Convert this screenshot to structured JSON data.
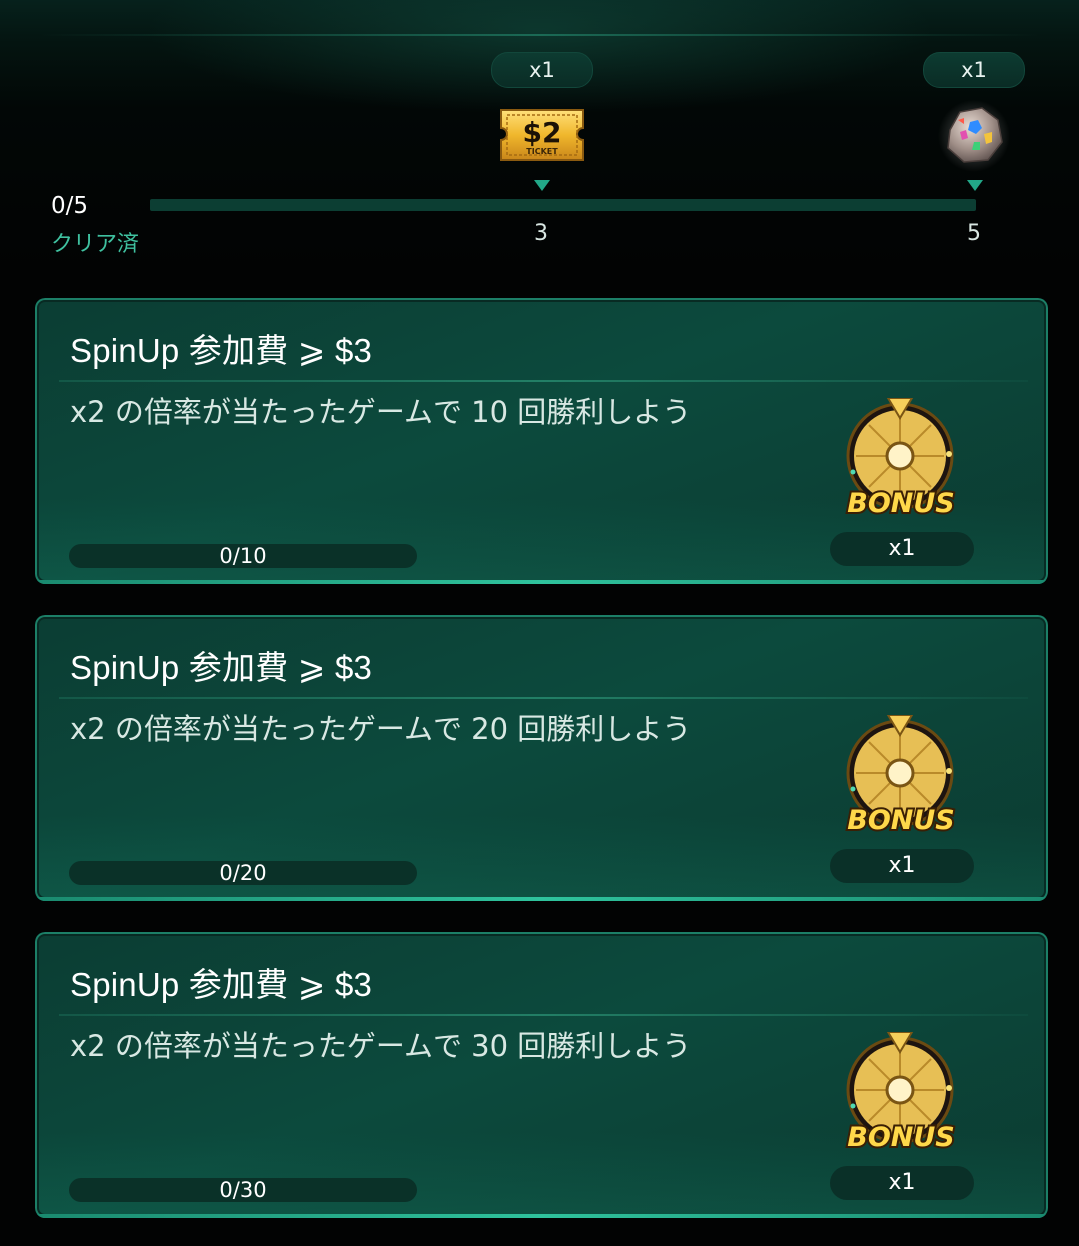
{
  "milestones": {
    "progress_count": "0/5",
    "progress_value": 0,
    "progress_max": 5,
    "cleared_label": "クリア済",
    "rewards": [
      {
        "step": "3",
        "count": "x1",
        "icon": "ticket-2-dollar-icon",
        "ticket_amount": "$2",
        "ticket_text": "TICKET"
      },
      {
        "step": "5",
        "count": "x1",
        "icon": "gem-rock-icon"
      }
    ]
  },
  "tasks": [
    {
      "title": "SpinUp 参加費 ⩾ $3",
      "description": "x2 の倍率が当たったゲームで 10 回勝利しよう",
      "progress_text": "0/10",
      "progress_value": 0,
      "progress_max": 10,
      "reward_icon": "bonus-wheel-icon",
      "reward_label": "BONUS",
      "reward_count": "x1"
    },
    {
      "title": "SpinUp 参加費 ⩾ $3",
      "description": "x2 の倍率が当たったゲームで 20 回勝利しよう",
      "progress_text": "0/20",
      "progress_value": 0,
      "progress_max": 20,
      "reward_icon": "bonus-wheel-icon",
      "reward_label": "BONUS",
      "reward_count": "x1"
    },
    {
      "title": "SpinUp 参加費 ⩾ $3",
      "description": "x2 の倍率が当たったゲームで 30 回勝利しよう",
      "progress_text": "0/30",
      "progress_value": 0,
      "progress_max": 30,
      "reward_icon": "bonus-wheel-icon",
      "reward_label": "BONUS",
      "reward_count": "x1"
    }
  ],
  "colors": {
    "accent": "#29c29a",
    "card_bg": "#0c4a3d",
    "label_teal": "#3fc1a0",
    "gold": "#e0b33c"
  }
}
